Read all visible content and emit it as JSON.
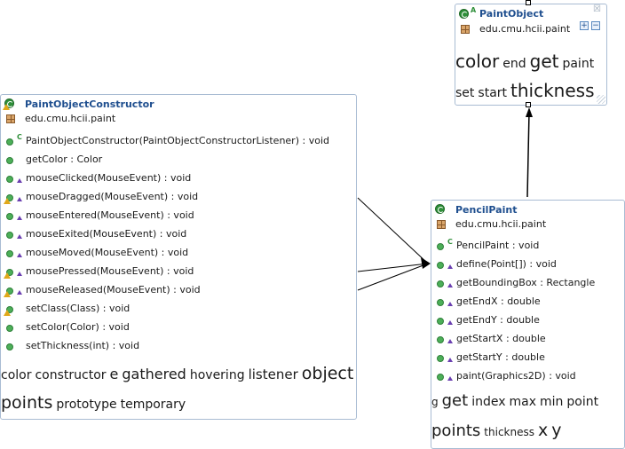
{
  "classes": {
    "paintObject": {
      "name": "PaintObject",
      "abstract_marker": "A",
      "package": "edu.cmu.hcii.paint",
      "controls": {
        "expand_label": "+",
        "collapse_label": "−",
        "close_label": "☒"
      },
      "tag_cloud_lines": [
        [
          {
            "word": "color",
            "size": "large"
          },
          {
            "word": "end",
            "size": "small"
          },
          {
            "word": "get",
            "size": "large"
          },
          {
            "word": "paint",
            "size": "small"
          }
        ],
        [
          {
            "word": "set",
            "size": "small"
          },
          {
            "word": "start",
            "size": "small"
          },
          {
            "word": "thickness",
            "size": "large"
          }
        ]
      ]
    },
    "paintObjectConstructor": {
      "name": "PaintObjectConstructor",
      "package": "edu.cmu.hcii.paint",
      "has_warning": true,
      "members": [
        {
          "text": "PaintObjectConstructor(PaintObjectConstructorListener) : void",
          "constructor": true,
          "protected": false,
          "warning": false
        },
        {
          "text": "getColor : Color",
          "constructor": false,
          "protected": false,
          "warning": false
        },
        {
          "text": "mouseClicked(MouseEvent) : void",
          "constructor": false,
          "protected": true,
          "warning": false
        },
        {
          "text": "mouseDragged(MouseEvent) : void",
          "constructor": false,
          "protected": true,
          "warning": true
        },
        {
          "text": "mouseEntered(MouseEvent) : void",
          "constructor": false,
          "protected": true,
          "warning": false
        },
        {
          "text": "mouseExited(MouseEvent) : void",
          "constructor": false,
          "protected": true,
          "warning": false
        },
        {
          "text": "mouseMoved(MouseEvent) : void",
          "constructor": false,
          "protected": true,
          "warning": false
        },
        {
          "text": "mousePressed(MouseEvent) : void",
          "constructor": false,
          "protected": true,
          "warning": true
        },
        {
          "text": "mouseReleased(MouseEvent) : void",
          "constructor": false,
          "protected": true,
          "warning": true
        },
        {
          "text": "setClass(Class) : void",
          "constructor": false,
          "protected": false,
          "warning": true
        },
        {
          "text": "setColor(Color) : void",
          "constructor": false,
          "protected": false,
          "warning": false
        },
        {
          "text": "setThickness(int) : void",
          "constructor": false,
          "protected": false,
          "warning": false
        }
      ],
      "tag_cloud_lines": [
        [
          {
            "word": "color",
            "size": "small"
          },
          {
            "word": "constructor",
            "size": "small"
          },
          {
            "word": "e",
            "size": "medium"
          },
          {
            "word": "gathered",
            "size": "medium"
          },
          {
            "word": "hovering",
            "size": "small"
          },
          {
            "word": "listener",
            "size": "medium"
          },
          {
            "word": "object",
            "size": "large"
          }
        ],
        [
          {
            "word": "points",
            "size": "large"
          },
          {
            "word": "prototype",
            "size": "small"
          },
          {
            "word": "temporary",
            "size": "small"
          }
        ]
      ]
    },
    "pencilPaint": {
      "name": "PencilPaint",
      "package": "edu.cmu.hcii.paint",
      "members": [
        {
          "text": "PencilPaint : void",
          "constructor": true,
          "protected": false,
          "warning": false
        },
        {
          "text": "define(Point[]) : void",
          "constructor": false,
          "protected": true,
          "warning": false
        },
        {
          "text": "getBoundingBox : Rectangle",
          "constructor": false,
          "protected": true,
          "warning": false
        },
        {
          "text": "getEndX : double",
          "constructor": false,
          "protected": true,
          "warning": false
        },
        {
          "text": "getEndY : double",
          "constructor": false,
          "protected": true,
          "warning": false
        },
        {
          "text": "getStartX : double",
          "constructor": false,
          "protected": true,
          "warning": false
        },
        {
          "text": "getStartY : double",
          "constructor": false,
          "protected": true,
          "warning": false
        },
        {
          "text": "paint(Graphics2D) : void",
          "constructor": false,
          "protected": true,
          "warning": false
        }
      ],
      "tag_cloud_lines": [
        [
          {
            "word": "g",
            "size": "xsmall"
          },
          {
            "word": "get",
            "size": "large"
          },
          {
            "word": "index",
            "size": "small"
          },
          {
            "word": "max",
            "size": "small"
          },
          {
            "word": "min",
            "size": "small"
          },
          {
            "word": "point",
            "size": "small"
          }
        ],
        [
          {
            "word": "points",
            "size": "large"
          },
          {
            "word": "thickness",
            "size": "xsmall"
          },
          {
            "word": "x",
            "size": "large"
          },
          {
            "word": "y",
            "size": "large"
          }
        ]
      ]
    }
  },
  "relations": [
    {
      "from": "paintObjectConstructor",
      "to": "pencilPaint",
      "kind": "reference"
    },
    {
      "from": "paintObjectConstructor",
      "to": "pencilPaint",
      "kind": "reference"
    },
    {
      "from": "paintObjectConstructor",
      "to": "pencilPaint",
      "kind": "reference"
    },
    {
      "from": "pencilPaint",
      "to": "paintObject",
      "kind": "inheritance"
    }
  ],
  "colors": {
    "title": "#1f4f8f",
    "border": "#a9bcd3",
    "method_dot": "#4caf58",
    "protected_marker": "#6a3fb0",
    "warning": "#e0a81a"
  }
}
